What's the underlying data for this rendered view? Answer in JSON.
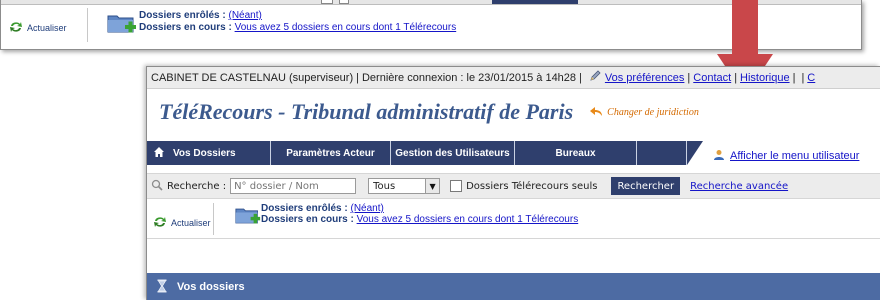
{
  "top_panel": {
    "refresh_label": "Actualiser",
    "enrolled_label": "Dossiers enrôlés :",
    "enrolled_link": "(Néant)",
    "in_progress_label": "Dossiers en cours :",
    "in_progress_link": "Vous avez 5 dossiers en cours dont 1 Télérecours"
  },
  "info_bar": {
    "user_text": "CABINET DE CASTELNAU (superviseur)",
    "last_login": "Dernière connexion : le 23/01/2015 à 14h28",
    "preferences_link": "Vos préférences",
    "contact_link": "Contact",
    "history_link": "Historique",
    "trailing_link": "C",
    "separator": "|"
  },
  "header": {
    "app_title": "TéléRecours - Tribunal administratif de Paris",
    "change_jurisdiction": "Changer de juridiction"
  },
  "nav": {
    "items": [
      {
        "label": "Vos Dossiers",
        "icon": "home-icon"
      },
      {
        "label": "Paramètres Acteur"
      },
      {
        "label": "Gestion des Utilisateurs"
      },
      {
        "label": "Bureaux"
      }
    ],
    "user_menu_link": "Afficher le menu utilisateur",
    "user_menu_icon": "user-icon"
  },
  "search": {
    "label": "Recherche :",
    "placeholder": "N° dossier / Nom",
    "select_value": "Tous",
    "checkbox_label": "Dossiers Télérecours seuls",
    "checkbox_checked": false,
    "submit_label": "Rechercher",
    "advanced_link": "Recherche avancée"
  },
  "status": {
    "refresh_label": "Actualiser",
    "enrolled_label": "Dossiers enrôlés :",
    "enrolled_link": "(Néant)",
    "in_progress_label": "Dossiers en cours :",
    "in_progress_link": "Vous avez 5 dossiers en cours dont 1 Télérecours"
  },
  "section": {
    "title": "Vos dossiers",
    "icon": "hourglass-icon"
  },
  "colors": {
    "nav_bg": "#2f3f6d",
    "title_color": "#3c5a8e",
    "accent_orange": "#d46a00",
    "section_header_bg": "#4d6ba3",
    "arrow_red": "#c9474a",
    "link_blue": "#1515c8"
  }
}
